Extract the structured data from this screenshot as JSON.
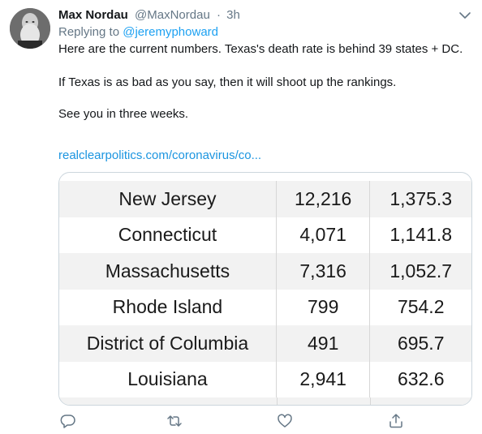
{
  "tweet": {
    "author_name": "Max Nordau",
    "author_handle": "@MaxNordau",
    "separator": "·",
    "time": "3h",
    "replying_prefix": "Replying to",
    "replying_handle": "@jeremyphoward",
    "paragraph_1": "Here are the current numbers. Texas's death rate is behind 39 states + DC.",
    "paragraph_2": "If Texas is as bad as you say, then it will shoot up the rankings.",
    "paragraph_3": "See you in three weeks.",
    "link_text": "realclearpolitics.com/coronavirus/co..."
  },
  "table": {
    "rows": [
      {
        "state": "New Jersey",
        "deaths": "12,216",
        "rate": "1,375.3"
      },
      {
        "state": "Connecticut",
        "deaths": "4,071",
        "rate": "1,141.8"
      },
      {
        "state": "Massachusetts",
        "deaths": "7,316",
        "rate": "1,052.7"
      },
      {
        "state": "Rhode Island",
        "deaths": "799",
        "rate": "754.2"
      },
      {
        "state": "District of Columbia",
        "deaths": "491",
        "rate": "695.7"
      },
      {
        "state": "Louisiana",
        "deaths": "2,941",
        "rate": "632.6"
      }
    ]
  },
  "actions": {
    "icons": [
      "reply-icon",
      "retweet-icon",
      "like-icon",
      "share-icon"
    ]
  },
  "colors": {
    "link": "#1da1f2",
    "muted": "#657786",
    "text": "#14171a"
  }
}
